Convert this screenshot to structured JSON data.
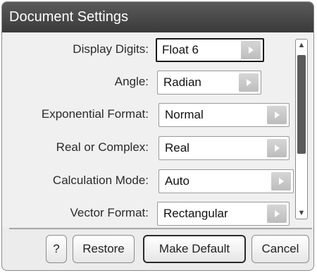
{
  "dialog": {
    "title": "Document Settings"
  },
  "settings": [
    {
      "label": "Display Digits:",
      "value": "Float 6"
    },
    {
      "label": "Angle:",
      "value": "Radian"
    },
    {
      "label": "Exponential Format:",
      "value": "Normal"
    },
    {
      "label": "Real or Complex:",
      "value": "Real"
    },
    {
      "label": "Calculation Mode:",
      "value": "Auto"
    },
    {
      "label": "Vector Format:",
      "value": "Rectangular"
    }
  ],
  "scrollbar": {
    "up_icon": "chevron-up-icon",
    "down_icon": "chevron-down-icon"
  },
  "buttons": {
    "help": "?",
    "restore": "Restore",
    "make_default": "Make Default",
    "cancel": "Cancel"
  }
}
